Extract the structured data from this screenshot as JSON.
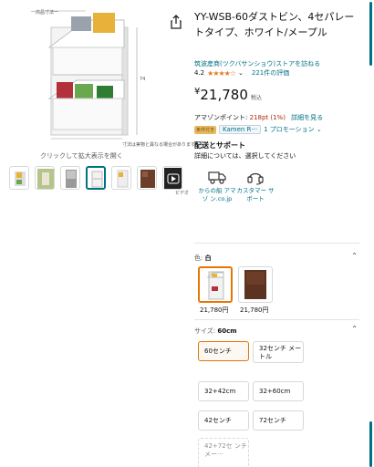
{
  "image": {
    "dim_label_top": "一商品寸法一",
    "dim_label_side": "74",
    "dim_label_note": "寸法は実物と異なる場合があります",
    "zoom_hint": "クリックして拡大表示を開く",
    "video_caption": "ビデオ"
  },
  "thumbnails": [
    {
      "name": "thumb-1",
      "active": false
    },
    {
      "name": "thumb-2",
      "active": false
    },
    {
      "name": "thumb-3",
      "active": false
    },
    {
      "name": "thumb-4",
      "active": true
    },
    {
      "name": "thumb-5",
      "active": false
    },
    {
      "name": "thumb-6",
      "active": false
    },
    {
      "name": "thumb-video",
      "active": false
    }
  ],
  "product": {
    "title": "YY-WSB-60ダストビン、4セパレートタイプ、ホワイト/メープル",
    "store_link": "筑波産商(ツクバサンショウ)ストアを訪ねる",
    "rating_value": "4.2",
    "stars": "★★★★☆",
    "rating_chevron": "⌄",
    "review_count": "221件の評価",
    "price_symbol": "¥",
    "price_value": "21,780",
    "price_tax": "税込",
    "points_label": "アマゾンポイント:",
    "points_value": "218pt (1%)",
    "points_link": "詳細を見る",
    "promo_badge": "条件付き",
    "promo_text": "Kamen R···",
    "promo_count": "1 プロモーション ⌄"
  },
  "delivery": {
    "heading": "配送とサポート",
    "note": "詳細については、選択してください",
    "services": [
      {
        "label": "からの船 アマゾ ン.co.jp",
        "icon": "truck-icon"
      },
      {
        "label": "カスタマー サポート",
        "icon": "headset-icon"
      }
    ]
  },
  "color_section": {
    "label": "色:",
    "selected": "白",
    "chevron": "⌃",
    "options": [
      {
        "name": "白",
        "price": "21,780円",
        "selected": true
      },
      {
        "name": "ブラウン",
        "price": "21,780円",
        "selected": false
      }
    ]
  },
  "size_section": {
    "label": "サイズ:",
    "selected": "60cm",
    "chevron": "⌃",
    "options": [
      {
        "label": "60センチ",
        "selected": true,
        "disabled": false
      },
      {
        "label": "32センチ メートル",
        "selected": false,
        "disabled": false
      },
      {
        "label": "32+42cm",
        "selected": false,
        "disabled": false
      },
      {
        "label": "32+60cm",
        "selected": false,
        "disabled": false
      },
      {
        "label": "42センチ",
        "selected": false,
        "disabled": false
      },
      {
        "label": "72センチ",
        "selected": false,
        "disabled": false
      },
      {
        "label": "42+72セ ンチメー···",
        "selected": false,
        "disabled": true
      }
    ]
  },
  "colors": {
    "link": "#007185",
    "price_red": "#b12704",
    "star": "#de7921",
    "selected_border": "#e77600"
  }
}
